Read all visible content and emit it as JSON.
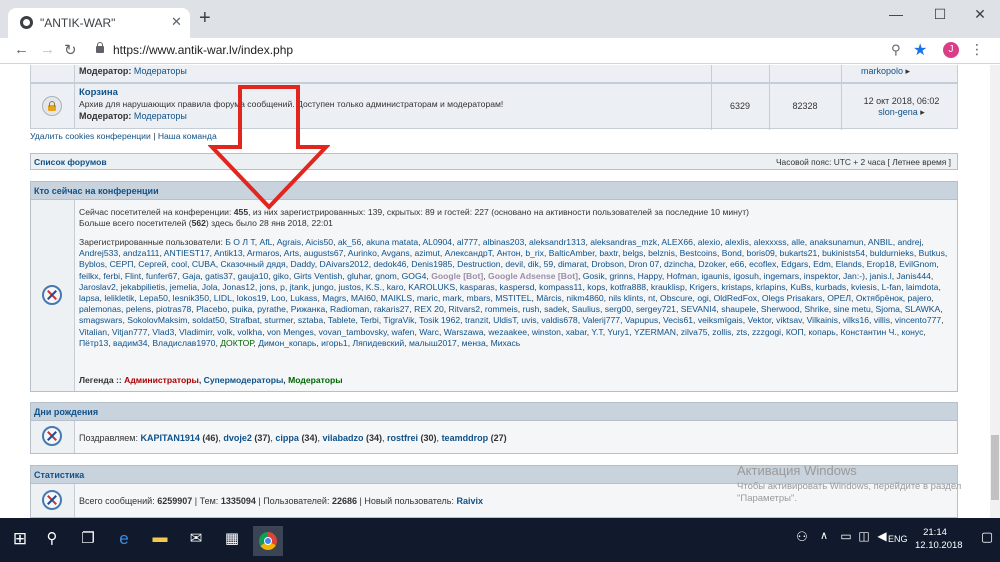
{
  "browser": {
    "tab_title": "\"ANTIK-WAR\"",
    "url": "https://www.antik-war.lv/index.php",
    "avatar_letter": "J"
  },
  "forum_top": {
    "moderator_label": "Модератор:",
    "moderator_value": "Модераторы",
    "last_user": "markopolo"
  },
  "forum_trash": {
    "title": "Корзина",
    "description": "Архив для нарушающих правила форума сообщений. Доступен только администраторам и модераторам!",
    "moderator_label": "Модератор:",
    "moderator_value": "Модераторы",
    "topics": "6329",
    "posts": "82328",
    "last_date": "12 окт 2018, 06:02",
    "last_user": "slon-gena"
  },
  "links": {
    "delete_cookies": "Удалить cookies конференции",
    "separator": "|",
    "team": "Наша команда"
  },
  "forum_list_bar": {
    "title": "Список форумов",
    "timezone": "Часовой пояс: UTC + 2 часа [ Летнее время ]"
  },
  "online": {
    "header": "Кто сейчас на конференции",
    "line1_prefix": "Сейчас посетителей на конференции:",
    "line1_count": "455",
    "line1_rest": ", из них зарегистрированных: 139, скрытых: 89 и гостей: 227 (основано на активности пользователей за последние 10 минут)",
    "line2_prefix": "Больше всего посетителей (",
    "line2_count": "562",
    "line2_rest": ") здесь было 28 янв 2018, 22:01",
    "registered_label": "Зарегистрированные пользователи:",
    "users": [
      {
        "n": "Б О Л Т",
        "c": "u"
      },
      {
        "n": "AfL",
        "c": "u"
      },
      {
        "n": "Agrais",
        "c": "u"
      },
      {
        "n": "Aicis50",
        "c": "u"
      },
      {
        "n": "ak_56",
        "c": "u"
      },
      {
        "n": "akuna matata",
        "c": "u"
      },
      {
        "n": "AL0904",
        "c": "u"
      },
      {
        "n": "al777",
        "c": "u"
      },
      {
        "n": "albinas203",
        "c": "u"
      },
      {
        "n": "aleksandr1313",
        "c": "u"
      },
      {
        "n": "aleksandras_mzk",
        "c": "u"
      },
      {
        "n": "ALEX66",
        "c": "u"
      },
      {
        "n": "alexio",
        "c": "u"
      },
      {
        "n": "alexlis",
        "c": "u"
      },
      {
        "n": "alexxxss",
        "c": "u"
      },
      {
        "n": "alle",
        "c": "u"
      },
      {
        "n": "anaksunamun",
        "c": "u"
      },
      {
        "n": "ANBIL",
        "c": "u"
      },
      {
        "n": "andrej",
        "c": "u"
      },
      {
        "n": "Andrej533",
        "c": "u"
      },
      {
        "n": "andza111",
        "c": "u"
      },
      {
        "n": "ANTIEST17",
        "c": "u"
      },
      {
        "n": "Antik13",
        "c": "u"
      },
      {
        "n": "Armaros",
        "c": "u"
      },
      {
        "n": "Arts",
        "c": "u"
      },
      {
        "n": "augusts67",
        "c": "u"
      },
      {
        "n": "Aurinko",
        "c": "u"
      },
      {
        "n": "Avgans",
        "c": "u"
      },
      {
        "n": "azimut",
        "c": "u"
      },
      {
        "n": "АлександрT",
        "c": "u"
      },
      {
        "n": "Антон",
        "c": "u"
      },
      {
        "n": "b_rix",
        "c": "u"
      },
      {
        "n": "BalticAmber",
        "c": "u"
      },
      {
        "n": "baxtr",
        "c": "u"
      },
      {
        "n": "belgs",
        "c": "u"
      },
      {
        "n": "belznis",
        "c": "u"
      },
      {
        "n": "Bestcoins",
        "c": "u"
      },
      {
        "n": "Bond",
        "c": "u"
      },
      {
        "n": "boris09",
        "c": "u"
      },
      {
        "n": "bukarts21",
        "c": "u"
      },
      {
        "n": "bukinists54",
        "c": "u"
      },
      {
        "n": "buldurnieks",
        "c": "u"
      },
      {
        "n": "Butkus",
        "c": "u"
      },
      {
        "n": "Byblos",
        "c": "u"
      },
      {
        "n": "СЕРП",
        "c": "u"
      },
      {
        "n": "Сергей",
        "c": "u"
      },
      {
        "n": "cool",
        "c": "u"
      },
      {
        "n": "CUBA",
        "c": "u"
      },
      {
        "n": "Сказочный дядя",
        "c": "u"
      },
      {
        "n": "Daddy",
        "c": "u"
      },
      {
        "n": "DAivars2012",
        "c": "u"
      },
      {
        "n": "dedok46",
        "c": "u"
      },
      {
        "n": "Denis1985",
        "c": "u"
      },
      {
        "n": "Destruction",
        "c": "u"
      },
      {
        "n": "devil",
        "c": "u"
      },
      {
        "n": "dik",
        "c": "u"
      },
      {
        "n": "59",
        "c": "u"
      },
      {
        "n": "dimarat",
        "c": "u"
      },
      {
        "n": "Drobson",
        "c": "u"
      },
      {
        "n": "Dron 07",
        "c": "u"
      },
      {
        "n": "dzincha",
        "c": "u"
      },
      {
        "n": "Dzoker",
        "c": "u"
      },
      {
        "n": "e66",
        "c": "u"
      },
      {
        "n": "ecoflex",
        "c": "u"
      },
      {
        "n": "Edgars",
        "c": "u"
      },
      {
        "n": "Edm",
        "c": "u"
      },
      {
        "n": "Elands",
        "c": "u"
      },
      {
        "n": "Erop18",
        "c": "u"
      },
      {
        "n": "EvilGnom",
        "c": "u"
      },
      {
        "n": "feilkx",
        "c": "u"
      },
      {
        "n": "ferbi",
        "c": "u"
      },
      {
        "n": "Flint",
        "c": "u"
      },
      {
        "n": "funfer67",
        "c": "u"
      },
      {
        "n": "Gaja",
        "c": "u"
      },
      {
        "n": "gatis37",
        "c": "u"
      },
      {
        "n": "gaujа10",
        "c": "u"
      },
      {
        "n": "giko",
        "c": "u"
      },
      {
        "n": "Girts Ventish",
        "c": "u"
      },
      {
        "n": "gluhar",
        "c": "u"
      },
      {
        "n": "gnom",
        "c": "u"
      },
      {
        "n": "GOG4",
        "c": "u"
      },
      {
        "n": "Google [Bot]",
        "c": "bot"
      },
      {
        "n": "Google Adsense [Bot]",
        "c": "bot"
      },
      {
        "n": "Gosik",
        "c": "u"
      },
      {
        "n": "grinns",
        "c": "u"
      },
      {
        "n": "Happy",
        "c": "u"
      },
      {
        "n": "Hofman",
        "c": "u"
      },
      {
        "n": "igaunis",
        "c": "u"
      },
      {
        "n": "igosuh",
        "c": "u"
      },
      {
        "n": "ingemars",
        "c": "u"
      },
      {
        "n": "inspektor",
        "c": "u"
      },
      {
        "n": "Jan:-)",
        "c": "u"
      },
      {
        "n": "janis.l",
        "c": "u"
      },
      {
        "n": "Janis444",
        "c": "u"
      },
      {
        "n": "Jaroslav2",
        "c": "u"
      },
      {
        "n": "jekabpilietis",
        "c": "u"
      },
      {
        "n": "jemelia",
        "c": "u"
      },
      {
        "n": "Jola",
        "c": "u"
      },
      {
        "n": "Jonas12",
        "c": "u"
      },
      {
        "n": "jons",
        "c": "u"
      },
      {
        "n": "p",
        "c": "u"
      },
      {
        "n": "jtank",
        "c": "u"
      },
      {
        "n": "jungo",
        "c": "u"
      },
      {
        "n": "justos",
        "c": "u"
      },
      {
        "n": "K.S.",
        "c": "u"
      },
      {
        "n": "karo",
        "c": "u"
      },
      {
        "n": "KAROLUKS",
        "c": "u"
      },
      {
        "n": "kasparas",
        "c": "u"
      },
      {
        "n": "kaspersd",
        "c": "u"
      },
      {
        "n": "kompass11",
        "c": "u"
      },
      {
        "n": "kops",
        "c": "u"
      },
      {
        "n": "kotfra888",
        "c": "u"
      },
      {
        "n": "krauklisp",
        "c": "u"
      },
      {
        "n": "Krigers",
        "c": "u"
      },
      {
        "n": "kristaps",
        "c": "u"
      },
      {
        "n": "krlapins",
        "c": "u"
      },
      {
        "n": "KuBs",
        "c": "u"
      },
      {
        "n": "kurbads",
        "c": "u"
      },
      {
        "n": "kviesis",
        "c": "u"
      },
      {
        "n": "L-fan",
        "c": "u"
      },
      {
        "n": "laimdota",
        "c": "u"
      },
      {
        "n": "lapsa",
        "c": "u"
      },
      {
        "n": "lelikletik",
        "c": "u"
      },
      {
        "n": "Lepa50",
        "c": "u"
      },
      {
        "n": "lesnik350",
        "c": "u"
      },
      {
        "n": "LIDL",
        "c": "u"
      },
      {
        "n": "lokos19",
        "c": "u"
      },
      {
        "n": "Loo",
        "c": "u"
      },
      {
        "n": "Lukass",
        "c": "u"
      },
      {
        "n": "Magrs",
        "c": "u"
      },
      {
        "n": "MAI60",
        "c": "u"
      },
      {
        "n": "MAIKLS",
        "c": "u"
      },
      {
        "n": "maric",
        "c": "u"
      },
      {
        "n": "mark",
        "c": "u"
      },
      {
        "n": "mbars",
        "c": "u"
      },
      {
        "n": "MSTITEL",
        "c": "u"
      },
      {
        "n": "Mārcis",
        "c": "u"
      },
      {
        "n": "nikm4860",
        "c": "u"
      },
      {
        "n": "nils klints",
        "c": "u"
      },
      {
        "n": "nt",
        "c": "u"
      },
      {
        "n": "Obscure",
        "c": "u"
      },
      {
        "n": "ogi",
        "c": "u"
      },
      {
        "n": "OldRedFox",
        "c": "u"
      },
      {
        "n": "Olegs Prisakars",
        "c": "u"
      },
      {
        "n": "OPEЛ",
        "c": "u"
      },
      {
        "n": "Октябрёнок",
        "c": "u"
      },
      {
        "n": "pajero",
        "c": "u"
      },
      {
        "n": "palemonas",
        "c": "u"
      },
      {
        "n": "pelens",
        "c": "u"
      },
      {
        "n": "piotras78",
        "c": "u"
      },
      {
        "n": "Placebo",
        "c": "u"
      },
      {
        "n": "puika",
        "c": "u"
      },
      {
        "n": "pyrathe",
        "c": "u"
      },
      {
        "n": "Рижанка",
        "c": "u"
      },
      {
        "n": "Radioman",
        "c": "u"
      },
      {
        "n": "rakaris27",
        "c": "u"
      },
      {
        "n": "REX 20",
        "c": "u"
      },
      {
        "n": "Ritvars2",
        "c": "u"
      },
      {
        "n": "rommeis",
        "c": "u"
      },
      {
        "n": "rush",
        "c": "u"
      },
      {
        "n": "sadek",
        "c": "u"
      },
      {
        "n": "Saulius",
        "c": "u"
      },
      {
        "n": "serg00",
        "c": "u"
      },
      {
        "n": "sergey721",
        "c": "u"
      },
      {
        "n": "SEVANI4",
        "c": "u"
      },
      {
        "n": "shaupele",
        "c": "u"
      },
      {
        "n": "Sherwood",
        "c": "u"
      },
      {
        "n": "Shrike",
        "c": "u"
      },
      {
        "n": "sine metu",
        "c": "u"
      },
      {
        "n": "Sjoma",
        "c": "u"
      },
      {
        "n": "SLAWKA",
        "c": "u"
      },
      {
        "n": "smagswars",
        "c": "u"
      },
      {
        "n": "SokolovMaksim",
        "c": "u"
      },
      {
        "n": "soldat50",
        "c": "u"
      },
      {
        "n": "Strafbat",
        "c": "u"
      },
      {
        "n": "sturmer",
        "c": "u"
      },
      {
        "n": "sztaba",
        "c": "u"
      },
      {
        "n": "Tablete",
        "c": "u"
      },
      {
        "n": "Terbi",
        "c": "u"
      },
      {
        "n": "TigraVik",
        "c": "u"
      },
      {
        "n": "Tosik 1962",
        "c": "u"
      },
      {
        "n": "tranzit",
        "c": "u"
      },
      {
        "n": "UldisT",
        "c": "u"
      },
      {
        "n": "uvis",
        "c": "u"
      },
      {
        "n": "valdis678",
        "c": "u"
      },
      {
        "n": "Valerij777",
        "c": "u"
      },
      {
        "n": "Vapupus",
        "c": "u"
      },
      {
        "n": "Vecis61",
        "c": "u"
      },
      {
        "n": "veiksmīgais",
        "c": "u"
      },
      {
        "n": "Vektor",
        "c": "u"
      },
      {
        "n": "viktsav",
        "c": "u"
      },
      {
        "n": "Vilkainis",
        "c": "u"
      },
      {
        "n": "vilks16",
        "c": "u"
      },
      {
        "n": "villis",
        "c": "u"
      },
      {
        "n": "vincento777",
        "c": "u"
      },
      {
        "n": "Vitalian",
        "c": "u"
      },
      {
        "n": "Vitjan777",
        "c": "u"
      },
      {
        "n": "Vlad3",
        "c": "u"
      },
      {
        "n": "Vladimirr",
        "c": "u"
      },
      {
        "n": "volk",
        "c": "u"
      },
      {
        "n": "volkha",
        "c": "u"
      },
      {
        "n": "von Menges",
        "c": "u"
      },
      {
        "n": "vovan_tambovsky",
        "c": "u"
      },
      {
        "n": "wafen",
        "c": "u"
      },
      {
        "n": "Warс",
        "c": "u"
      },
      {
        "n": "Warszawa",
        "c": "u"
      },
      {
        "n": "wezaakee",
        "c": "u"
      },
      {
        "n": "winston",
        "c": "u"
      },
      {
        "n": "xabar",
        "c": "u"
      },
      {
        "n": "Y.T",
        "c": "u"
      },
      {
        "n": "Yury1",
        "c": "u"
      },
      {
        "n": "YZERMAN",
        "c": "u"
      },
      {
        "n": "zilva75",
        "c": "u"
      },
      {
        "n": "zollis",
        "c": "u"
      },
      {
        "n": "zts",
        "c": "u"
      },
      {
        "n": "zzzgogi",
        "c": "u"
      },
      {
        "n": "КОП",
        "c": "u"
      },
      {
        "n": "копарь",
        "c": "u"
      },
      {
        "n": "Константин Ч.",
        "c": "u"
      },
      {
        "n": "конус",
        "c": "u"
      },
      {
        "n": "Пётр13",
        "c": "u"
      },
      {
        "n": "вадим34",
        "c": "u"
      },
      {
        "n": "Владислав1970",
        "c": "u"
      },
      {
        "n": "ДОКТОР",
        "c": "mdr"
      },
      {
        "n": "Димон_копарь",
        "c": "u"
      },
      {
        "n": "игорь1",
        "c": "u"
      },
      {
        "n": "Ляпидевский",
        "c": "u"
      },
      {
        "n": "малыш2017",
        "c": "u"
      },
      {
        "n": "мензa",
        "c": "u"
      },
      {
        "n": "Михась",
        "c": "u"
      }
    ],
    "legend_label": "Легенда ::",
    "legend_admins": "Администраторы",
    "legend_supermods": "Супермодераторы",
    "legend_mods": "Модераторы"
  },
  "birthdays": {
    "header": "Дни рождения",
    "prefix": "Поздравляем:",
    "items": [
      {
        "name": "KAPITAN1914",
        "age": "(46)"
      },
      {
        "name": "dvoje2",
        "age": "(37)"
      },
      {
        "name": "cippa",
        "age": "(34)"
      },
      {
        "name": "vilabadzo",
        "age": "(34)"
      },
      {
        "name": "rostfrei",
        "age": "(30)"
      },
      {
        "name": "teamddrop",
        "age": "(27)"
      }
    ]
  },
  "stats": {
    "header": "Статистика",
    "posts_label": "Всего сообщений:",
    "posts": "6259907",
    "topics_label": "Тем:",
    "topics": "1335094",
    "users_label": "Пользователей:",
    "users": "22686",
    "new_user_label": "Новый пользователь:",
    "new_user": "Raivix"
  },
  "activation": {
    "line1": "Активация Windows",
    "line2": "Чтобы активировать Windows, перейдите в раздел \"Параметры\"."
  },
  "taskbar": {
    "time": "21:14",
    "date": "12.10.2018",
    "lang": "ENG"
  },
  "colors": {
    "arrow": "#e0261e",
    "link": "#105289",
    "admin": "#aa0000",
    "moderator": "#006600"
  }
}
